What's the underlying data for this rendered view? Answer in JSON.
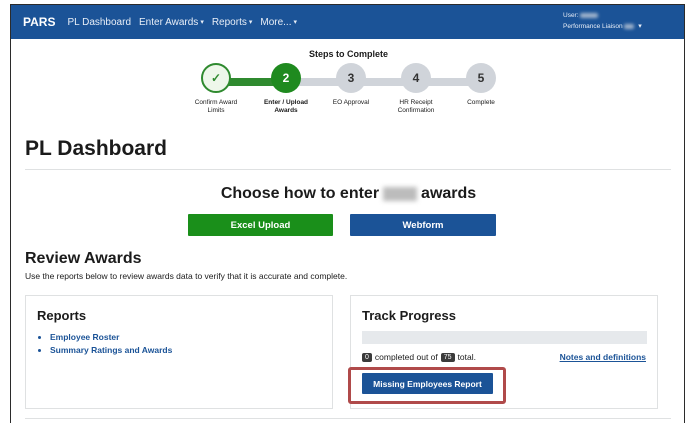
{
  "navbar": {
    "brand": "PARS",
    "items": [
      {
        "label": "PL Dashboard",
        "dropdown": false
      },
      {
        "label": "Enter Awards",
        "dropdown": true
      },
      {
        "label": "Reports",
        "dropdown": true
      },
      {
        "label": "More...",
        "dropdown": true
      }
    ],
    "caret": "▾",
    "user_label": "User:",
    "role_label": "Performance Liaison"
  },
  "stepper": {
    "title": "Steps to Complete",
    "steps": [
      {
        "number": "✓",
        "label_lines": [
          "Confirm Award",
          "Limits"
        ],
        "state": "complete"
      },
      {
        "number": "2",
        "label_lines": [
          "Enter / Upload",
          "Awards"
        ],
        "state": "active"
      },
      {
        "number": "3",
        "label_lines": [
          "EO Approval",
          ""
        ],
        "state": "pending"
      },
      {
        "number": "4",
        "label_lines": [
          "HR Receipt",
          "Confirmation"
        ],
        "state": "pending"
      },
      {
        "number": "5",
        "label_lines": [
          "Complete",
          ""
        ],
        "state": "pending"
      }
    ]
  },
  "page": {
    "title": "PL Dashboard",
    "choose_prefix": "Choose how to enter",
    "choose_suffix": "awards",
    "excel_button": "Excel Upload",
    "webform_button": "Webform",
    "review_title": "Review Awards",
    "review_desc": "Use the reports below to review awards data to verify that it is accurate and complete."
  },
  "reports_card": {
    "title": "Reports",
    "links": [
      "Employee Roster",
      "Summary Ratings and Awards"
    ]
  },
  "track_card": {
    "title": "Track Progress",
    "progress_fraction": 0,
    "completed": "0",
    "completed_text": "completed out of",
    "total": "75",
    "total_text": "total.",
    "notes_link": "Notes and definitions",
    "missing_button": "Missing Employees Report"
  },
  "colors": {
    "primary": "#1b5397",
    "success": "#1a8f1a",
    "highlight": "#b04a4a"
  }
}
